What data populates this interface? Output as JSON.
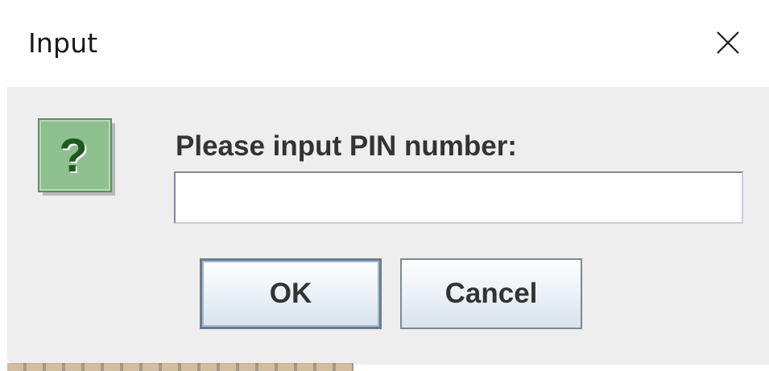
{
  "window": {
    "title": "Input",
    "close_symbol": "✕"
  },
  "dialog": {
    "icon": "question-icon",
    "icon_glyph": "?",
    "prompt": "Please input PIN number:",
    "pin_input": {
      "value": "",
      "placeholder": ""
    },
    "buttons": {
      "ok_label": "OK",
      "cancel_label": "Cancel"
    }
  },
  "colors": {
    "content_background": "#eeeeee",
    "icon_green": "#8fc08f",
    "icon_dark_green": "#1e5a1e",
    "button_border": "#7a8a99",
    "text": "#333333"
  }
}
